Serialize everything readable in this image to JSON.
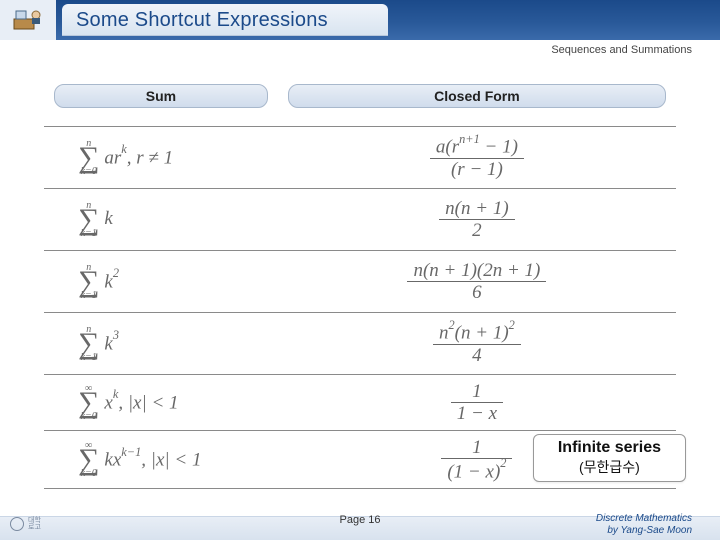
{
  "header": {
    "title": "Some Shortcut Expressions",
    "subtitle": "Sequences and Summations"
  },
  "table": {
    "col_sum": "Sum",
    "col_closed": "Closed Form",
    "rows": [
      {
        "sum_upper": "n",
        "sum_lower": "k=0",
        "sum_body_html": "ar<sup>k</sup>, r ≠ 1",
        "cf_num_html": "a(r<sup>n+1</sup> − 1)",
        "cf_den_html": "(r − 1)"
      },
      {
        "sum_upper": "n",
        "sum_lower": "k=1",
        "sum_body_html": "k",
        "cf_num_html": "n(n + 1)",
        "cf_den_html": "2"
      },
      {
        "sum_upper": "n",
        "sum_lower": "k=1",
        "sum_body_html": "k<sup>2</sup>",
        "cf_num_html": "n(n + 1)(2n + 1)",
        "cf_den_html": "6"
      },
      {
        "sum_upper": "n",
        "sum_lower": "k=1",
        "sum_body_html": "k<sup>3</sup>",
        "cf_num_html": "n<sup>2</sup>(n + 1)<sup>2</sup>",
        "cf_den_html": "4"
      },
      {
        "sum_upper": "∞",
        "sum_lower": "k=0",
        "sum_body_html": "x<sup>k</sup>, |x| < 1",
        "cf_num_html": "1",
        "cf_den_html": "1 − x"
      },
      {
        "sum_upper": "∞",
        "sum_lower": "k=0",
        "sum_body_html": "kx<sup>k−1</sup>, |x| < 1",
        "cf_num_html": "1",
        "cf_den_html": "(1 − x)<sup>2</sup>"
      }
    ]
  },
  "callout": {
    "line1": "Infinite series",
    "line2": "(무한급수)"
  },
  "footer": {
    "page": "Page 16",
    "credit1": "Discrete Mathematics",
    "credit2": "by Yang-Sae Moon"
  }
}
